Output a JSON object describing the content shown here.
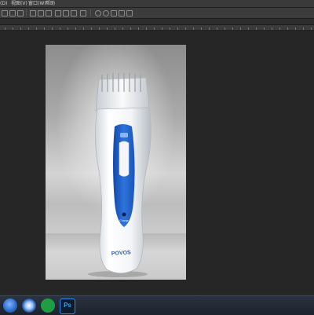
{
  "menubar": {
    "items": [
      {
        "label": "(D)"
      },
      {
        "label": "视图(V)"
      },
      {
        "label": "窗口(W)"
      },
      {
        "label": "帮助"
      }
    ]
  },
  "product": {
    "brand": "POVOS",
    "button_label": "Charge",
    "colors": {
      "body": "#f4f6f8",
      "accent": "#1e63c7",
      "comb": "#e9ecef"
    }
  },
  "taskbar": {
    "apps": [
      {
        "icon": "start-orb-icon"
      },
      {
        "icon": "browser-icon"
      },
      {
        "icon": "chat-icon"
      },
      {
        "icon": "photoshop-icon",
        "label": "Ps"
      }
    ]
  }
}
